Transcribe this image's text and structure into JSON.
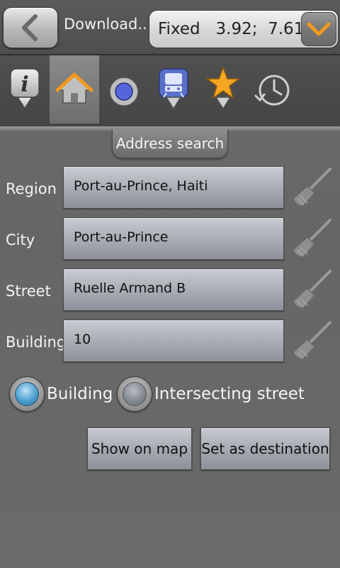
{
  "header": {
    "title": "Download...",
    "gps_status": "Fixed   3.92;  7.61"
  },
  "toolbar": {
    "items": [
      {
        "icon": "info-icon"
      },
      {
        "icon": "home-icon",
        "selected": true
      },
      {
        "icon": "point-icon"
      },
      {
        "icon": "transit-icon"
      },
      {
        "icon": "star-icon"
      },
      {
        "icon": "history-icon"
      }
    ]
  },
  "section": {
    "title": "Address search"
  },
  "form": {
    "region_label": "Region",
    "region_value": "Port-au-Prince, Haiti",
    "city_label": "City",
    "city_value": "Port-au-Prince",
    "street_label": "Street",
    "street_value": "Ruelle Armand B",
    "building_label": "Building",
    "building_value": "10"
  },
  "radios": {
    "building_label": "Building",
    "intersecting_label": "Intersecting street",
    "selected": "building"
  },
  "actions": {
    "show_on_map": "Show on map",
    "set_destination": "Set as destination"
  },
  "colors": {
    "accent_orange": "#f39a1e",
    "radio_selected_blue": "#4a9fcf"
  }
}
